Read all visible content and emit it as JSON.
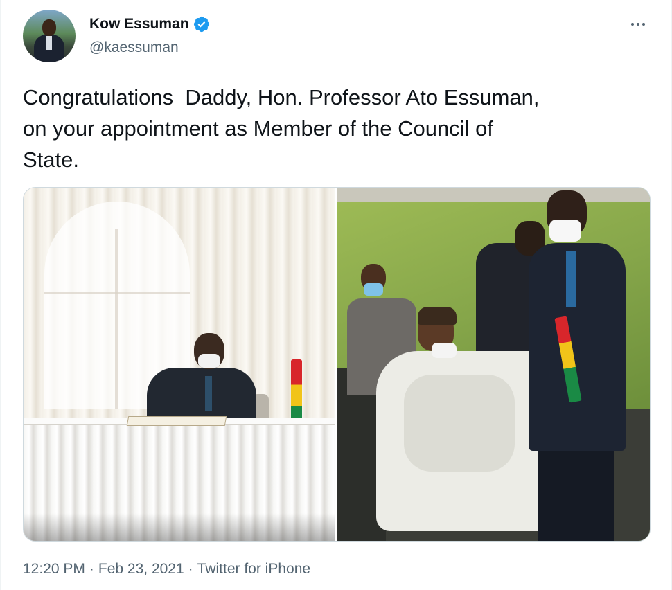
{
  "author": {
    "name": "Kow Essuman",
    "handle": "@kaessuman",
    "verified": true,
    "verified_color": "#1d9bf0"
  },
  "tweet": {
    "text": "Congratulations  Daddy, Hon. Professor Ato Essuman,\non your appointment as Member of the Council of\nState."
  },
  "meta": {
    "time": "12:20 PM",
    "date": "Feb 23, 2021",
    "source": "Twitter for iPhone",
    "separator": "·"
  },
  "icons": {
    "more": "more-horizontal-icon",
    "verified": "verified-badge-icon"
  },
  "colors": {
    "text": "#0f1419",
    "secondary": "#536471",
    "border": "#cfd9de"
  }
}
